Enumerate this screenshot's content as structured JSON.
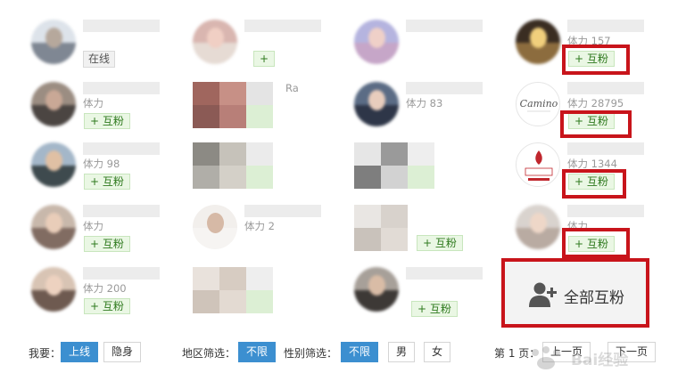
{
  "grid": {
    "cards": [
      {
        "stat": "",
        "action": "在线",
        "action_type": "online"
      },
      {
        "stat": "体力",
        "action": "+ 互粉",
        "action_type": "follow"
      },
      {
        "stat": "体力 98",
        "action": "+ 互粉",
        "action_type": "follow"
      },
      {
        "stat": "体力",
        "action": "+ 互粉",
        "action_type": "follow"
      },
      {
        "stat": "体力 200",
        "action": "+ 互粉",
        "action_type": "follow"
      },
      {
        "stat": "",
        "action": "+",
        "action_type": "follow"
      },
      {
        "stat": "",
        "action": "",
        "action_type": "none"
      },
      {
        "stat": "",
        "action": "",
        "action_type": "none"
      },
      {
        "stat": "体力 2",
        "action": "",
        "action_type": "none"
      },
      {
        "stat": "",
        "action": "",
        "action_type": "none"
      },
      {
        "stat": "",
        "action": "",
        "action_type": "none"
      },
      {
        "stat": "体力 83",
        "action": "",
        "action_type": "none"
      },
      {
        "stat": "",
        "action": "",
        "action_type": "none"
      },
      {
        "stat": "",
        "action": "+ 互粉",
        "action_type": "follow"
      },
      {
        "stat": "",
        "action": "+ 互粉",
        "action_type": "follow"
      },
      {
        "stat": "体力 157",
        "action": "+ 互粉",
        "action_type": "follow"
      },
      {
        "stat": "体力 28795",
        "action": "+ 互粉",
        "action_type": "follow"
      },
      {
        "stat": "体力 1344",
        "action": "+ 互粉",
        "action_type": "follow"
      },
      {
        "stat": "体力",
        "action": "+ 互粉",
        "action_type": "follow"
      }
    ],
    "partial_name": "Ra"
  },
  "all_follow": {
    "label": "全部互粉",
    "icon": "user-add-icon"
  },
  "filters": {
    "want_label": "我要：",
    "want_options": [
      "上线",
      "隐身"
    ],
    "region_label": "地区筛选：",
    "region_options": [
      "不限"
    ],
    "gender_label": "性别筛选：",
    "gender_options": [
      "不限",
      "男",
      "女"
    ],
    "page_label": "第 1 页：",
    "prev_label": "上一页",
    "next_label": "下一页"
  },
  "watermark": {
    "text": "Bai经验"
  },
  "colors": {
    "highlight": "#c8141b",
    "active_filter": "#3c8fd0",
    "follow_bg": "#eaf7e4",
    "follow_text": "#2f7a1e"
  }
}
